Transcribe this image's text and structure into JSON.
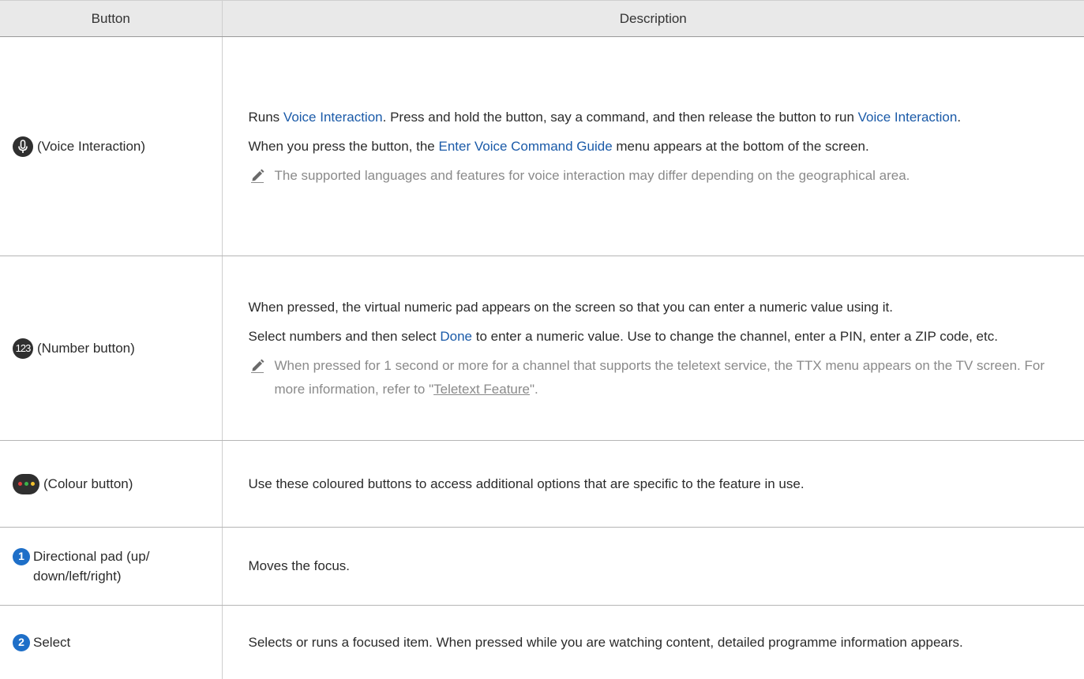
{
  "header": {
    "col_button": "Button",
    "col_description": "Description"
  },
  "rows": [
    {
      "icon": "mic-icon",
      "button_label": "(Voice Interaction)",
      "desc1": [
        "Runs ",
        "Voice Interaction",
        ". Press and hold the button, say a command, and then release the button to run ",
        "Voice Interaction",
        "."
      ],
      "desc2": [
        "When you press the button, the ",
        "Enter Voice Command Guide",
        " menu appears at the bottom of the screen."
      ],
      "note": "The supported languages and features for voice interaction may differ depending on the geographical area."
    },
    {
      "icon": "number-icon",
      "icon_text": "123",
      "button_label": "(Number button)",
      "desc1": "When pressed, the virtual numeric pad appears on the screen so that you can enter a numeric value using it.",
      "desc2": [
        "Select numbers and then select ",
        "Done",
        " to enter a numeric value. Use to change the channel, enter a PIN, enter a ZIP code, etc."
      ],
      "note": [
        "When pressed for 1 second or more for a channel that supports the teletext service, the TTX menu appears on the TV screen. For more information, refer to \"",
        "Teletext Feature",
        "\"."
      ]
    },
    {
      "icon": "colour-dots-icon",
      "button_label": "(Colour button)",
      "desc1": "Use these coloured buttons to access additional options that are specific to the feature in use."
    },
    {
      "icon": "badge-1-icon",
      "icon_text": "1",
      "button_label": "Directional pad (up/ down/left/right)",
      "desc1": "Moves the focus."
    },
    {
      "icon": "badge-2-icon",
      "icon_text": "2",
      "button_label": "Select",
      "desc1": "Selects or runs a focused item. When pressed while you are watching content, detailed programme information appears."
    }
  ],
  "colors": {
    "highlight": "#1a5aa8",
    "badge": "#1e6fc8",
    "dot_red": "#e03c3c",
    "dot_green": "#3cb44b",
    "dot_yellow": "#f2c12e",
    "note_text": "#8a8a8a"
  }
}
